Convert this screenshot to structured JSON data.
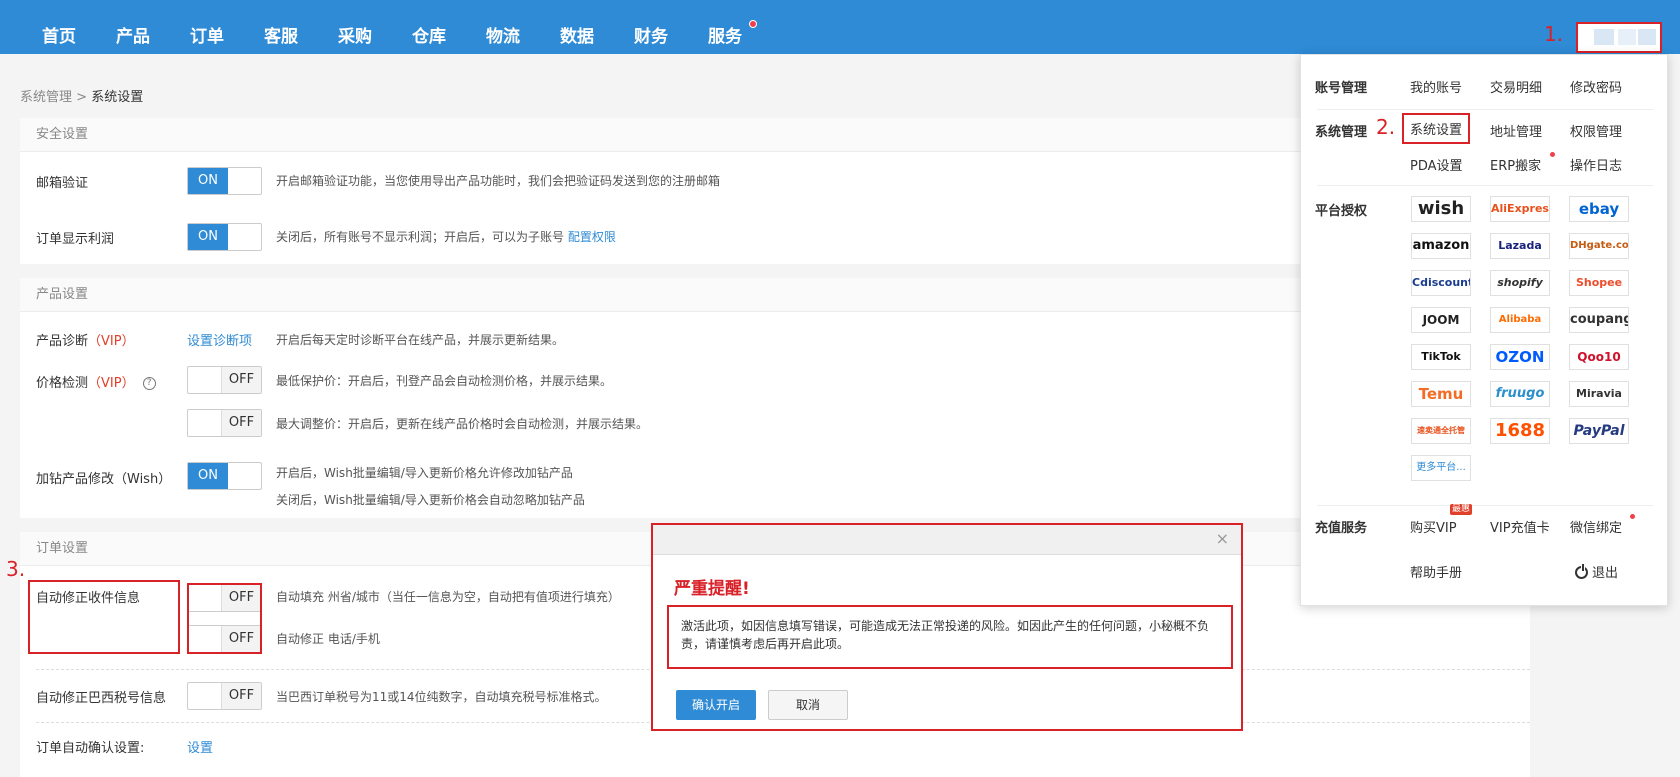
{
  "nav": {
    "items": [
      "首页",
      "产品",
      "订单",
      "客服",
      "采购",
      "仓库",
      "物流",
      "数据",
      "财务",
      "服务"
    ]
  },
  "markers": {
    "m1": "1.",
    "m2": "2.",
    "m3": "3."
  },
  "breadcrumb": {
    "parent": "系统管理",
    "sep": ">",
    "current": "系统设置"
  },
  "security": {
    "header": "安全设置",
    "email_label": "邮箱验证",
    "email_toggle": "ON",
    "email_desc": "开启邮箱验证功能，当您使用导出产品功能时，我们会把验证码发送到您的注册邮箱",
    "profit_label": "订单显示利润",
    "profit_toggle": "ON",
    "profit_desc": "关闭后，所有账号不显示利润；开启后，可以为子账号",
    "profit_link": "配置权限"
  },
  "product": {
    "header": "产品设置",
    "diag_label": "产品诊断",
    "diag_vip": "（VIP）",
    "diag_link": "设置诊断项",
    "diag_desc": "开启后每天定时诊断平台在线产品，并展示更新结果。",
    "price_label": "价格检测",
    "price_vip": "（VIP）",
    "help_icon": "?",
    "price_toggle1": "OFF",
    "price_desc1": "最低保护价：开启后，刊登产品会自动检测价格，并展示结果。",
    "price_toggle2": "OFF",
    "price_desc2": "最大调整价：开启后，更新在线产品价格时会自动检测，并展示结果。",
    "shipping_label": "加钻产品修改（Wish）",
    "shipping_toggle": "ON",
    "shipping_desc1": "开启后，Wish批量编辑/导入更新价格允许修改加钻产品",
    "shipping_desc2": "关闭后，Wish批量编辑/导入更新价格会自动忽略加钻产品"
  },
  "order": {
    "header": "订单设置",
    "address_label": "自动修正收件信息",
    "address_toggle1": "OFF",
    "address_desc1": "自动填充 州省/城市（当任一信息为空，自动把有值项进行填充）",
    "address_toggle2": "OFF",
    "address_desc2": "自动修正 电话/手机",
    "tax_label": "自动修正巴西税号信息",
    "tax_toggle": "OFF",
    "tax_desc": "当巴西订单税号为11或14位纯数字，自动填充税号标准格式。",
    "confirm_label": "订单自动确认设置:",
    "confirm_link": "设置"
  },
  "dropdown": {
    "account_label": "账号管理",
    "account_items": [
      "我的账号",
      "交易明细",
      "修改密码"
    ],
    "system_label": "系统管理",
    "system_items": [
      "系统设置",
      "地址管理",
      "权限管理",
      "PDA设置",
      "ERP搬家",
      "操作日志"
    ],
    "platform_label": "平台授权",
    "platforms": [
      "wish",
      "AliExpress",
      "ebay",
      "amazon",
      "Lazada",
      "DHgate.com",
      "Cdiscount",
      "shopify",
      "Shopee",
      "JOOM",
      "Alibaba",
      "coupang",
      "TikTok",
      "OZON",
      "Qoo10",
      "Temu",
      "fruugo",
      "Miravia",
      "速卖通全托管",
      "1688",
      "PayPal",
      "更多平台..."
    ],
    "recharge_label": "充值服务",
    "recharge_items": [
      "购买VIP",
      "VIP充值卡",
      "微信绑定"
    ],
    "vip_badge": "最惠",
    "help": "帮助手册",
    "logout": "退出"
  },
  "modal": {
    "close": "×",
    "title": "严重提醒!",
    "body": "激活此项，如因信息填写错误，可能造成无法正常投递的风险。如因此产生的任何问题，小秘概不负责，请谨慎考虑后再开启此项。",
    "confirm": "确认开启",
    "cancel": "取消"
  }
}
